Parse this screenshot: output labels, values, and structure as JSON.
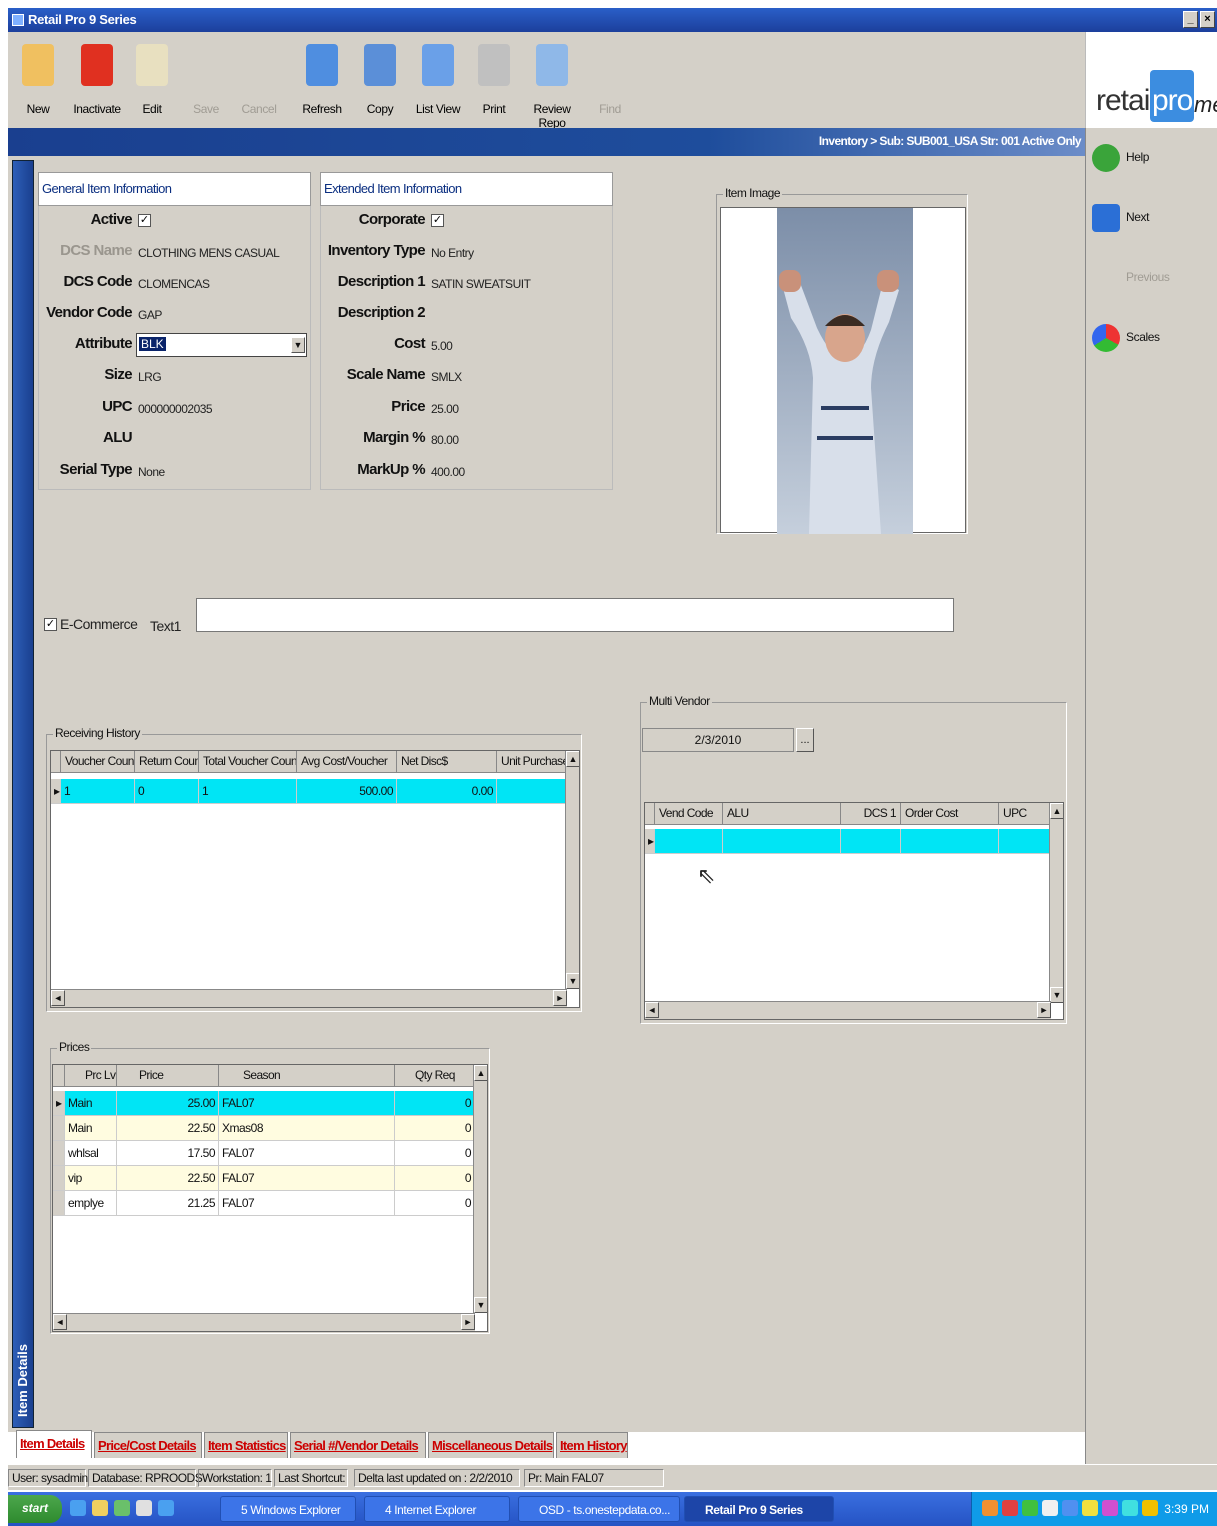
{
  "window": {
    "title": "Retail Pro 9 Series",
    "controls": [
      "_",
      "×"
    ]
  },
  "toolbar": {
    "buttons": [
      {
        "label": "New",
        "icon": "new-document-icon",
        "enabled": true,
        "color": "#f0c060"
      },
      {
        "label": "Inactivate",
        "icon": "red-x-icon",
        "enabled": true,
        "color": "#e03020"
      },
      {
        "label": "Edit",
        "icon": "edit-pencil-icon",
        "enabled": true,
        "color": "#e8e0c0"
      },
      {
        "label": "Save",
        "icon": "save-icon",
        "enabled": false,
        "color": "#d4d0c8"
      },
      {
        "label": "Cancel",
        "icon": "cancel-icon",
        "enabled": false,
        "color": "#d4d0c8"
      },
      {
        "label": "Refresh",
        "icon": "refresh-icon",
        "enabled": true,
        "color": "#4f8ee0"
      },
      {
        "label": "Copy",
        "icon": "copy-icon",
        "enabled": true,
        "color": "#5b8fd8"
      },
      {
        "label": "List View",
        "icon": "list-view-icon",
        "enabled": true,
        "color": "#6aa0e8"
      },
      {
        "label": "Print",
        "icon": "printer-icon",
        "enabled": true,
        "color": "#c0c0c0"
      },
      {
        "label": "Review Repo",
        "icon": "review-report-icon",
        "enabled": true,
        "color": "#8fb8e8"
      },
      {
        "label": "Find",
        "icon": "find-icon",
        "enabled": false,
        "color": "#d4d0c8"
      }
    ]
  },
  "logo": {
    "retail": "retail",
    "pro": "pro",
    "me": "me"
  },
  "breadcrumb": "Inventory > Sub: SUB001_USA Str: 001 Active Only",
  "sidebar": {
    "help": "Help",
    "next": "Next",
    "previous": "Previous",
    "scales": "Scales"
  },
  "general": {
    "title": "General Item Information",
    "active_label": "Active",
    "active": true,
    "dcs_name_label": "DCS Name",
    "dcs_name": "CLOTHING MENS     CASUAL",
    "dcs_code_label": "DCS Code",
    "dcs_code": "CLOMENCAS",
    "vendor_code_label": "Vendor Code",
    "vendor_code": "GAP",
    "attribute_label": "Attribute",
    "attribute": "BLK",
    "size_label": "Size",
    "size": "LRG",
    "upc_label": "UPC",
    "upc": "000000002035",
    "alu_label": "ALU",
    "alu": "",
    "serial_type_label": "Serial Type",
    "serial_type": "None"
  },
  "extended": {
    "title": "Extended Item Information",
    "corporate_label": "Corporate",
    "corporate": true,
    "inventory_type_label": "Inventory Type",
    "inventory_type": "No Entry",
    "description1_label": "Description 1",
    "description1": "SATIN SWEATSUIT",
    "description2_label": "Description 2",
    "description2": "",
    "cost_label": "Cost",
    "cost": "5.00",
    "scale_name_label": "Scale Name",
    "scale_name": "SMLX",
    "price_label": "Price",
    "price": "25.00",
    "margin_label": "Margin %",
    "margin": "80.00",
    "markup_label": "MarkUp %",
    "markup": "400.00"
  },
  "item_image": {
    "title": "Item Image"
  },
  "ecommerce": {
    "label": "E-Commerce",
    "checked": true,
    "text1_label": "Text1",
    "text1_value": ""
  },
  "receiving_history": {
    "title": "Receiving History",
    "columns": [
      "Voucher Count",
      "Return Count",
      "Total Voucher Count",
      "Avg Cost/Voucher",
      "Net Disc$",
      "Unit Purchase"
    ],
    "rows": [
      [
        "1",
        "0",
        "1",
        "500.00",
        "0.00",
        ""
      ]
    ]
  },
  "multi_vendor": {
    "title": "Multi Vendor",
    "date": "2/3/2010",
    "date_button": "...",
    "columns": [
      "Vend Code",
      "ALU",
      "DCS 1",
      "Order Cost",
      "UPC"
    ],
    "rows": [
      [
        "",
        "",
        "",
        "",
        ""
      ]
    ]
  },
  "prices": {
    "title": "Prices",
    "columns": [
      "Prc Lvl",
      "Price",
      "Season",
      "Qty Req"
    ],
    "rows": [
      [
        "Main",
        "25.00",
        "FAL07",
        "0"
      ],
      [
        "Main",
        "22.50",
        "Xmas08",
        "0"
      ],
      [
        "whlsal",
        "17.50",
        "FAL07",
        "0"
      ],
      [
        "vip",
        "22.50",
        "FAL07",
        "0"
      ],
      [
        "emplye",
        "21.25",
        "FAL07",
        "0"
      ]
    ]
  },
  "tabs": [
    "Item Details",
    "Price/Cost Details",
    "Item Statistics",
    "Serial #/Vendor Details",
    "Miscellaneous Details",
    "Item History"
  ],
  "vertical_tab": "Item Details",
  "status": {
    "user": "User: sysadmin",
    "database": "Database: RPROODS",
    "workstation": "Workstation: 1",
    "last_shortcut": "Last Shortcut:",
    "delta": "Delta last updated on : 2/2/2010",
    "pr": "Pr: Main FAL07"
  },
  "taskbar": {
    "start": "start",
    "tasks": [
      "5 Windows Explorer",
      "4 Internet Explorer",
      "OSD - ts.onestepdata.co...",
      "Retail Pro 9 Series"
    ],
    "clock": "3:39 PM"
  },
  "colors": {
    "selection": "#00e5f5",
    "alt_row": "#fffce0",
    "accent": "#1a3f8f"
  }
}
